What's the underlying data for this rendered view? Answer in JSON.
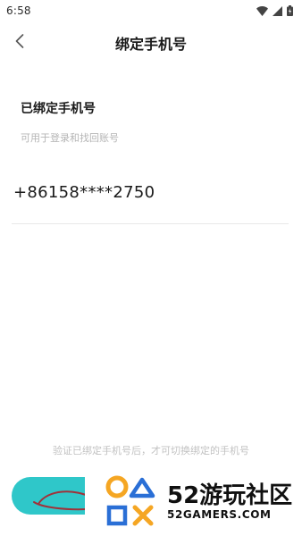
{
  "status_bar": {
    "time": "6:58"
  },
  "header": {
    "title": "绑定手机号"
  },
  "bound": {
    "title": "已绑定手机号",
    "subtitle": "可用于登录和找回账号",
    "phone": "+86158****2750"
  },
  "footer": {
    "hint": "验证已绑定手机号后，才可切换绑定的手机号"
  },
  "watermark": {
    "name": "52游玩社区",
    "domain": "52GAMERS.COM"
  },
  "colors": {
    "accent": "#2fc7c9",
    "logo_orange": "#f5a623",
    "logo_blue": "#2a6fd6"
  }
}
